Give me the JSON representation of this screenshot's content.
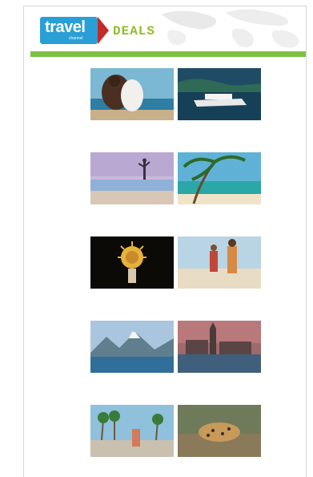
{
  "header": {
    "logo_text": "travel",
    "logo_sub": "channel",
    "section_label": "DEALS"
  },
  "banner": {
    "text": ""
  },
  "deals": [
    {
      "meta": "",
      "title": "",
      "desc": ""
    },
    {
      "meta": "",
      "title": "",
      "desc": ""
    },
    {
      "meta": "",
      "title": "",
      "desc": ""
    },
    {
      "meta": "",
      "title": "",
      "desc": ""
    },
    {
      "meta": "",
      "title": "",
      "desc": ""
    },
    {
      "meta": "",
      "title": "",
      "desc": ""
    },
    {
      "meta": "",
      "title": "",
      "desc": ""
    },
    {
      "meta": "",
      "title": "",
      "desc": ""
    },
    {
      "meta": "",
      "title": "",
      "desc": ""
    },
    {
      "meta": "",
      "title": "",
      "desc": ""
    }
  ],
  "colors": {
    "logo_blue": "#2a9fd6",
    "logo_red": "#c42a2a",
    "deals_green": "#8fbf2a",
    "banner_green": "#7dc143"
  }
}
